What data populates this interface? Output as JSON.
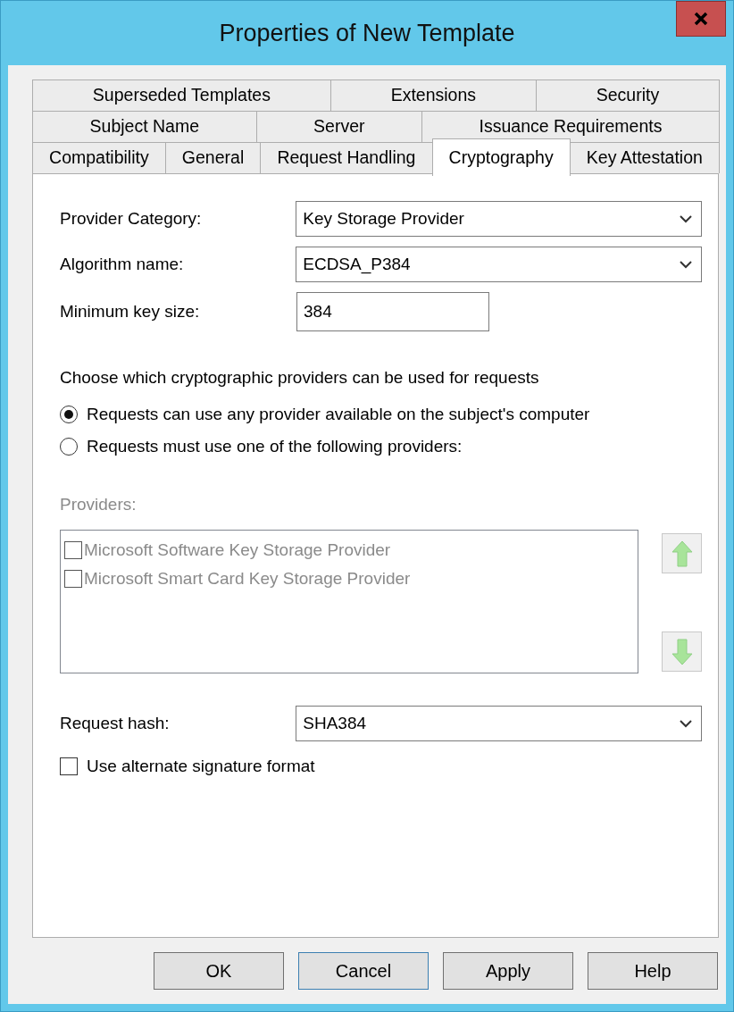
{
  "window": {
    "title": "Properties of New Template"
  },
  "tab_rows": [
    [
      {
        "label": "Superseded Templates",
        "selected": false
      },
      {
        "label": "Extensions",
        "selected": false
      },
      {
        "label": "Security",
        "selected": false
      }
    ],
    [
      {
        "label": "Subject Name",
        "selected": false
      },
      {
        "label": "Server",
        "selected": false
      },
      {
        "label": "Issuance Requirements",
        "selected": false
      }
    ],
    [
      {
        "label": "Compatibility",
        "selected": false
      },
      {
        "label": "General",
        "selected": false
      },
      {
        "label": "Request Handling",
        "selected": false
      },
      {
        "label": "Cryptography",
        "selected": true
      },
      {
        "label": "Key Attestation",
        "selected": false
      }
    ]
  ],
  "fields": [
    {
      "kind": "dropdown",
      "label": "Provider Category:",
      "value": "Key Storage Provider"
    },
    {
      "kind": "dropdown",
      "label": "Algorithm name:",
      "value": "ECDSA_P384"
    },
    {
      "kind": "text",
      "label": "Minimum key size:",
      "value": "384"
    }
  ],
  "provider_choice": {
    "prompt": "Choose which cryptographic providers can be used for requests",
    "options": [
      {
        "label": "Requests can use any provider available on the subject's computer",
        "selected": true
      },
      {
        "label": "Requests must use one of the following providers:",
        "selected": false
      }
    ]
  },
  "providers": {
    "label": "Providers:",
    "disabled": true,
    "items": [
      {
        "label": "Microsoft Software Key Storage Provider",
        "checked": false
      },
      {
        "label": "Microsoft Smart Card Key Storage Provider",
        "checked": false
      }
    ]
  },
  "request_hash": {
    "label": "Request hash:",
    "value": "SHA384"
  },
  "alternate_signature": {
    "label": "Use alternate signature format",
    "checked": false
  },
  "buttons": [
    {
      "label": "OK",
      "default": false
    },
    {
      "label": "Cancel",
      "default": true
    },
    {
      "label": "Apply",
      "default": false
    },
    {
      "label": "Help",
      "default": false
    }
  ]
}
